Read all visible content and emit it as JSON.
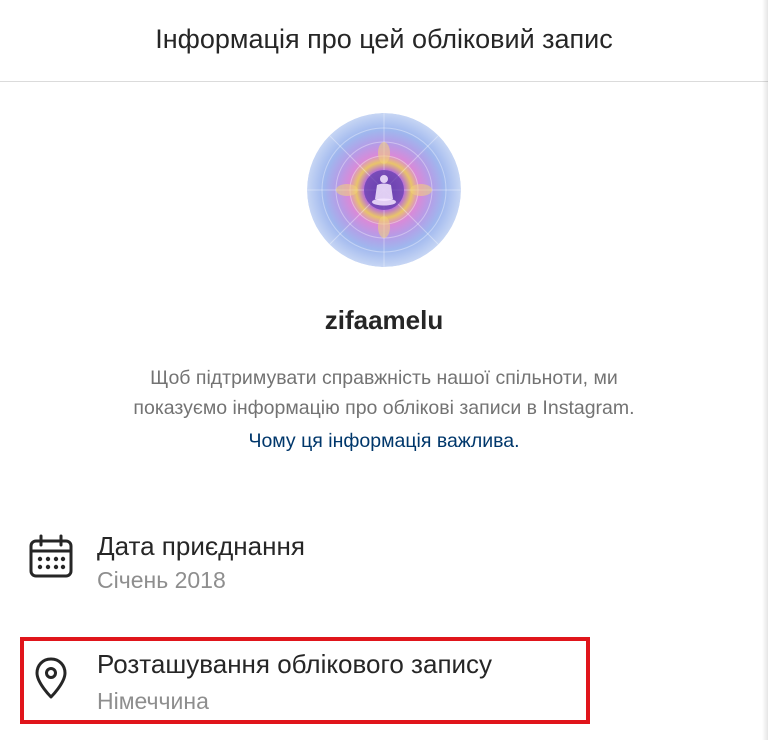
{
  "dialog": {
    "title": "Інформація про цей обліковий запис"
  },
  "profile": {
    "username": "zifaamelu",
    "description_line1": "Щоб підтримувати справжність нашої спільноти, ми",
    "description_line2": "показуємо інформацію про облікові записи в Instagram.",
    "why_link": "Чому ця інформація важлива."
  },
  "details": {
    "join_date": {
      "icon": "calendar-icon",
      "label": "Дата приєднання",
      "value": "Січень 2018"
    },
    "location": {
      "icon": "location-pin-icon",
      "label": "Розташування облікового запису",
      "value": "Німеччина"
    }
  },
  "colors": {
    "link": "#00376b",
    "secondary_text": "#737373",
    "highlight": "#e0151b"
  }
}
